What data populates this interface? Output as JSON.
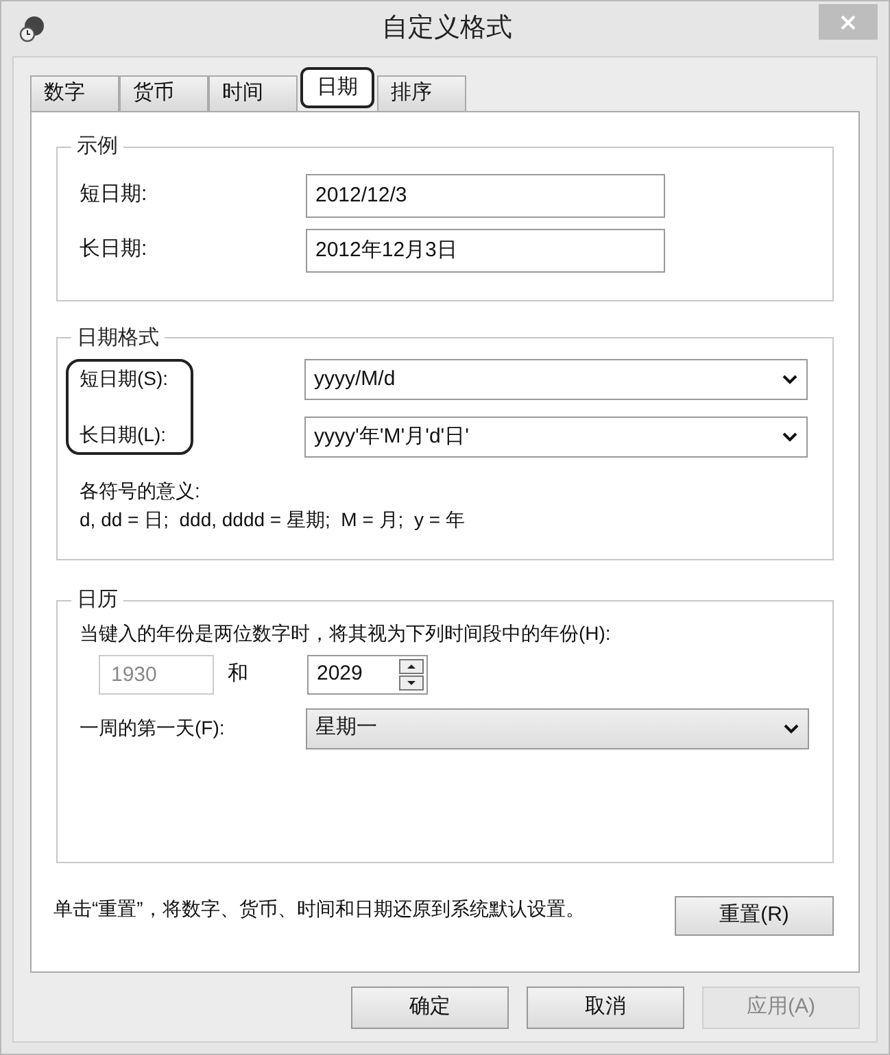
{
  "window": {
    "title": "自定义格式"
  },
  "tabs": [
    {
      "label": "数字",
      "selected": false
    },
    {
      "label": "货币",
      "selected": false
    },
    {
      "label": "时间",
      "selected": false
    },
    {
      "label": "日期",
      "selected": true
    },
    {
      "label": "排序",
      "selected": false
    }
  ],
  "example": {
    "title": "示例",
    "rows": [
      {
        "label": "短日期:",
        "value": "2012/12/3"
      },
      {
        "label": "长日期:",
        "value": "2012年12月3日"
      }
    ]
  },
  "date_formats": {
    "title": "日期格式",
    "highlighted": true,
    "rows": [
      {
        "label": "短日期(S):",
        "value": "yyyy/M/d"
      },
      {
        "label": "长日期(L):",
        "value": "yyyy'年'M'月'd'日'"
      }
    ],
    "legend_title": "各符号的意义:",
    "legend": "d, dd = 日;  ddd, dddd = 星期;  M = 月;  y = 年"
  },
  "calendar": {
    "title": "日历",
    "two_digit_label": "当键入的年份是两位数字时，将其视为下列时间段中的年份(H):",
    "from_year": {
      "value": "1930",
      "disabled": true
    },
    "and_label": "和",
    "to_year": "2029",
    "first_day_label": "一周的第一天(F):",
    "first_day": "星期一"
  },
  "reset": {
    "note": "单击“重置”，将数字、货币、时间和日期还原到系统默认设置。",
    "button": "重置(R)"
  },
  "buttons": [
    {
      "label": "确定",
      "disabled": false
    },
    {
      "label": "取消",
      "disabled": false
    },
    {
      "label": "应用(A)",
      "disabled": true
    }
  ]
}
